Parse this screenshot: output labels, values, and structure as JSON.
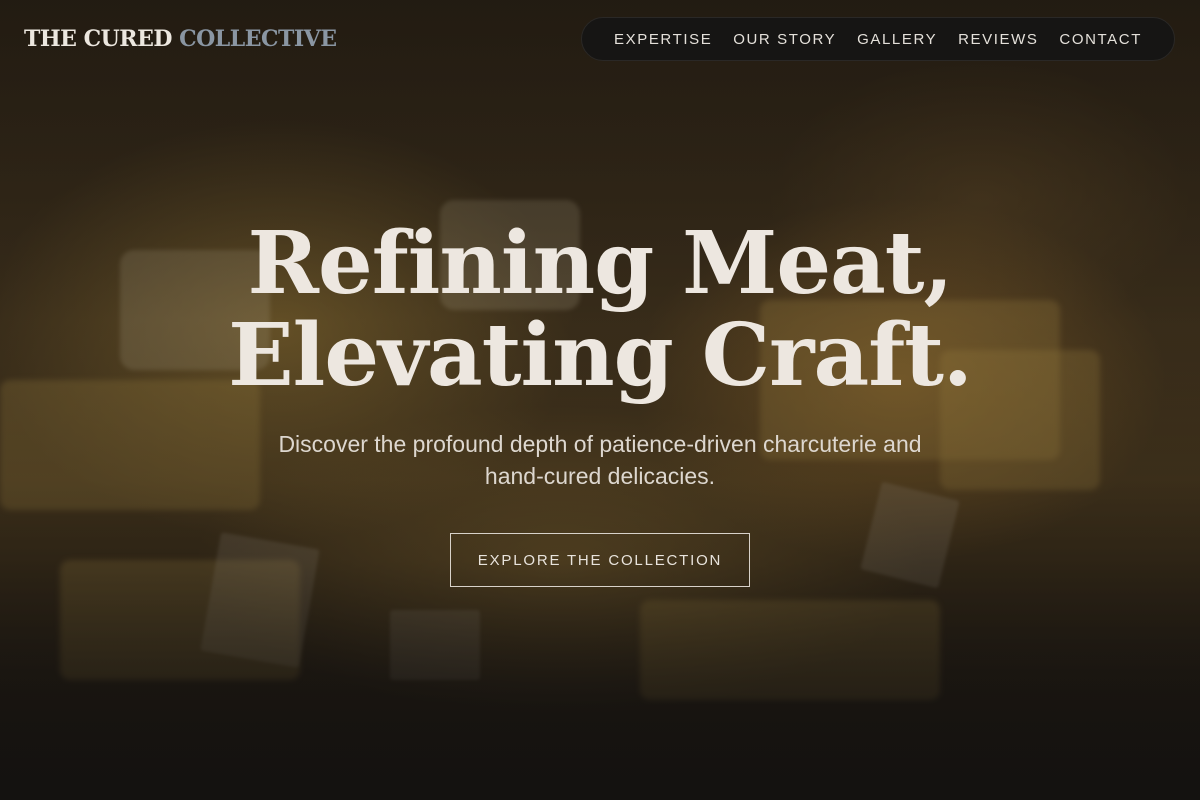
{
  "brand": {
    "name_main": "THE CURED",
    "name_accent": "COLLECTIVE"
  },
  "nav": {
    "items": [
      {
        "label": "EXPERTISE"
      },
      {
        "label": "OUR STORY"
      },
      {
        "label": "GALLERY"
      },
      {
        "label": "REVIEWS"
      },
      {
        "label": "CONTACT"
      }
    ]
  },
  "hero": {
    "headline_line1": "Refining Meat,",
    "headline_line2": "Elevating Craft.",
    "subtitle": "Discover the profound depth of patience-driven charcuterie and hand-cured delicacies.",
    "cta_label": "EXPLORE THE COLLECTION"
  },
  "colors": {
    "text_light": "#ede7e0",
    "logo_accent": "#8a96a3",
    "nav_bg": "#161514",
    "background_dark": "#1a1612"
  }
}
